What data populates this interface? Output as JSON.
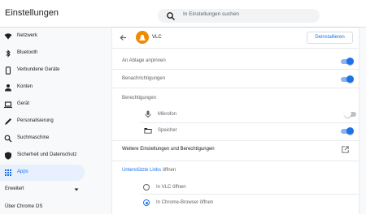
{
  "app": {
    "title": "Einstellungen"
  },
  "search": {
    "placeholder": "In Einstellungen suchen"
  },
  "sidebar": {
    "items": [
      {
        "label": "Netzwerk",
        "icon": "wifi-icon"
      },
      {
        "label": "Bluetooth",
        "icon": "bluetooth-icon"
      },
      {
        "label": "Verbundene Geräte",
        "icon": "phone-icon"
      },
      {
        "label": "Konten",
        "icon": "person-icon"
      },
      {
        "label": "Gerät",
        "icon": "laptop-icon"
      },
      {
        "label": "Personalisierung",
        "icon": "pen-icon"
      },
      {
        "label": "Suchmaschine",
        "icon": "search-icon"
      },
      {
        "label": "Sicherheit und Datenschutz",
        "icon": "shield-icon"
      },
      {
        "label": "Apps",
        "icon": "apps-grid-icon",
        "active": true
      }
    ],
    "advanced": "Erweitert",
    "about": "Über Chrome OS"
  },
  "app_detail": {
    "name": "VLC",
    "uninstall_label": "Deinstallieren",
    "pin_label": "An Ablage anpinnen",
    "pin_enabled": true,
    "notifications_label": "Benachrichtigungen",
    "notifications_enabled": true,
    "permissions_header": "Berechtigungen",
    "permissions": [
      {
        "label": "Mikrofon",
        "icon": "microphone-icon",
        "enabled": false
      },
      {
        "label": "Speicher",
        "icon": "folder-icon",
        "enabled": true
      }
    ],
    "more_settings_label": "Weitere Einstellungen und Berechtigungen",
    "supported_links": {
      "link_text": "Unterstützte Links",
      "rest_text": " öffnen"
    },
    "open_options": [
      {
        "label": "In VLC öffnen",
        "selected": false
      },
      {
        "label": "In Chrome-Browser öffnen",
        "selected": true
      }
    ]
  },
  "colors": {
    "accent": "#1a73e8",
    "active_bg": "#e8f0fe",
    "vlc_orange": "#f08a00"
  }
}
